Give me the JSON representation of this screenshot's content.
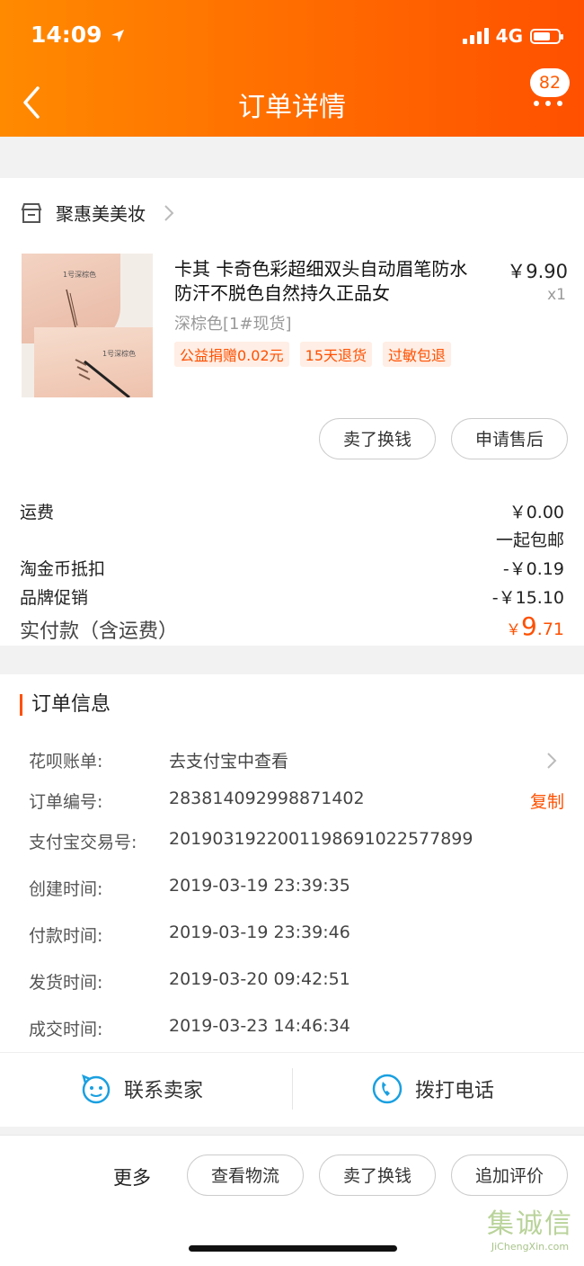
{
  "status_bar": {
    "time": "14:09",
    "network": "4G"
  },
  "header": {
    "title": "订单详情",
    "badge_count": "82"
  },
  "shop": {
    "name": "聚惠美美妆"
  },
  "product": {
    "title": "卡其 卡奇色彩超细双头自动眉笔防水防汗不脱色自然持久正品女",
    "price": "￥9.90",
    "qty": "x1",
    "sku": "深棕色[1#现货]",
    "tags": [
      "公益捐赠0.02元",
      "15天退货",
      "过敏包退"
    ],
    "thumb_labels": [
      "1号深棕色",
      "1号深棕色"
    ]
  },
  "actions": {
    "sell": "卖了换钱",
    "after_sale": "申请售后"
  },
  "fees": {
    "shipping_label": "运费",
    "shipping_value": "￥0.00",
    "shipping_note": "一起包邮",
    "coin_label": "淘金币抵扣",
    "coin_value": "-￥0.19",
    "promo_label": "品牌促销",
    "promo_value": "-￥15.10",
    "paid_label": "实付款（含运费）",
    "paid_currency": "￥",
    "paid_int": "9",
    "paid_dec": ".71"
  },
  "order_info": {
    "title": "订单信息",
    "rows": [
      {
        "label": "花呗账单:",
        "value": "去支付宝中查看"
      },
      {
        "label": "订单编号:",
        "value": "283814092998871402"
      },
      {
        "label": "支付宝交易号:",
        "value": "2019031922001198691022577899"
      },
      {
        "label": "创建时间:",
        "value": "2019-03-19 23:39:35"
      },
      {
        "label": "付款时间:",
        "value": "2019-03-19 23:39:46"
      },
      {
        "label": "发货时间:",
        "value": "2019-03-20 09:42:51"
      },
      {
        "label": "成交时间:",
        "value": "2019-03-23 14:46:34"
      }
    ],
    "copy_label": "复制"
  },
  "contact": {
    "seller": "联系卖家",
    "phone": "拨打电话"
  },
  "bottom": {
    "more": "更多",
    "logistics": "查看物流",
    "sell": "卖了换钱",
    "review": "追加评价"
  },
  "watermark": {
    "chars": "集诚信",
    "domain": "JiChengXin.com"
  },
  "colors": {
    "accent": "#ff5000",
    "header_start": "#ff8a00",
    "header_end": "#ff5000",
    "link_blue": "#1aa0e0"
  }
}
